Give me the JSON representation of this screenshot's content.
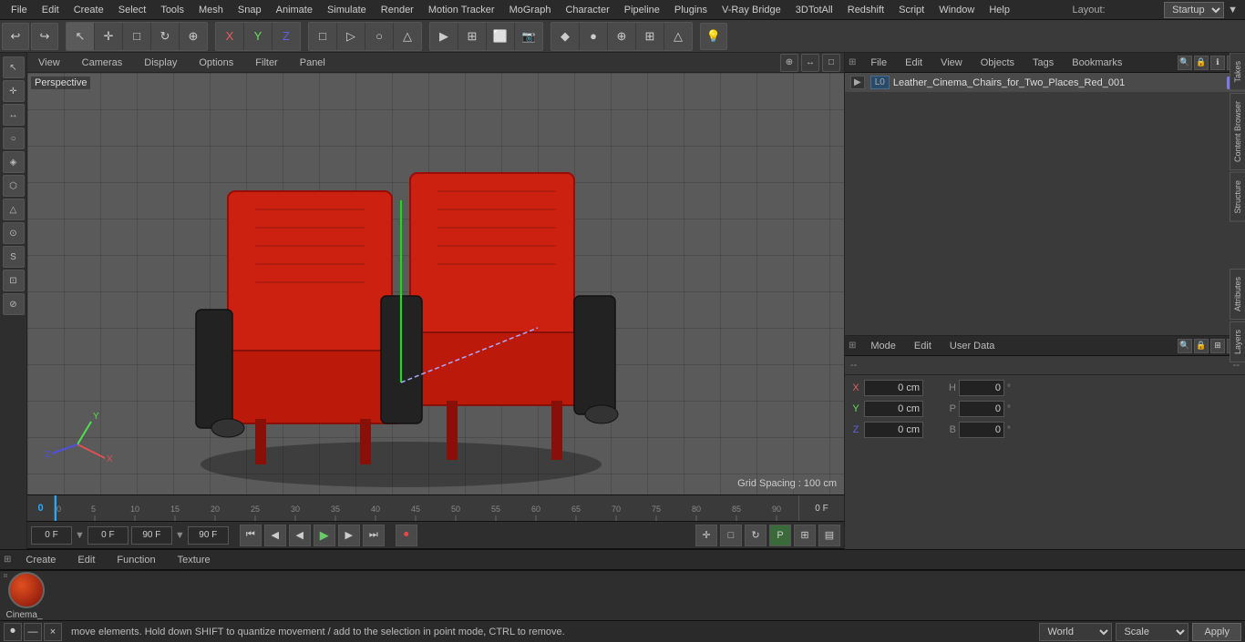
{
  "app": {
    "title": "Cinema 4D"
  },
  "menu": {
    "items": [
      "File",
      "Edit",
      "Create",
      "Select",
      "Tools",
      "Mesh",
      "Snap",
      "Animate",
      "Simulate",
      "Render",
      "Motion Tracker",
      "MoGraph",
      "Character",
      "Pipeline",
      "Plugins",
      "V-Ray Bridge",
      "3DTotAll",
      "Redshift",
      "Script",
      "Window",
      "Help"
    ],
    "layout_label": "Layout:",
    "layout_value": "Startup"
  },
  "toolbar": {
    "undo_icon": "↩",
    "redo_icon": "↪",
    "mode_icons": [
      "↖",
      "+",
      "□",
      "↻",
      "⊕"
    ],
    "axis_icons": [
      "X",
      "Y",
      "Z"
    ],
    "shape_icons": [
      "□",
      "▷",
      "○",
      "△"
    ],
    "render_icons": [
      "▶",
      "⊞",
      "⬜",
      "📷"
    ],
    "object_icons": [
      "◆",
      "●",
      "⊕",
      "⊞",
      "△"
    ],
    "light_icon": "💡"
  },
  "viewport": {
    "label": "Perspective",
    "tabs": [
      "View",
      "Cameras",
      "Display",
      "Options",
      "Filter",
      "Panel"
    ],
    "grid_spacing": "Grid Spacing : 100 cm"
  },
  "timeline": {
    "frame_start": "0",
    "frame_end": "0 F",
    "ticks": [
      "0",
      "5",
      "10",
      "15",
      "20",
      "25",
      "30",
      "35",
      "40",
      "45",
      "50",
      "55",
      "60",
      "65",
      "70",
      "75",
      "80",
      "85",
      "90"
    ],
    "current_frame_display": "0 F"
  },
  "playback": {
    "field1_value": "0 F",
    "field2_value": "0 F",
    "field3_value": "90 F",
    "field4_value": "90 F",
    "buttons": [
      "⏮",
      "◀◀",
      "◀",
      "▶",
      "▶▶",
      "⏭",
      "⏺"
    ]
  },
  "object_panel": {
    "tabs": [
      "File",
      "Edit",
      "View",
      "Objects",
      "Tags",
      "Bookmarks"
    ],
    "object_name": "Leather_Cinema_Chairs_for_Two_Places_Red_001",
    "object_icon": "L0",
    "vtabs": [
      "Takes",
      "Content Browser",
      "Structure"
    ]
  },
  "attributes_panel": {
    "tabs": [
      "Mode",
      "Edit",
      "User Data"
    ],
    "header_dashes": [
      "--",
      "--"
    ],
    "rows": [
      {
        "label": "X",
        "value1": "0 cm",
        "unit1": "",
        "label2": "H",
        "value2": "0 °"
      },
      {
        "label": "Y",
        "value1": "0 cm",
        "unit1": "",
        "label2": "P",
        "value2": "0 °"
      },
      {
        "label": "Z",
        "value1": "0 cm",
        "unit1": "",
        "label2": "B",
        "value2": "0 °"
      }
    ],
    "vtabs": [
      "Attributes",
      "Layers"
    ]
  },
  "material_bar": {
    "tabs": [
      "Create",
      "Edit",
      "Function",
      "Texture"
    ],
    "material_name": "Cinema_",
    "icons": [
      "mat1"
    ]
  },
  "bottom_bar": {
    "status_text": "move elements. Hold down SHIFT to quantize movement / add to the selection in point mode, CTRL to remove.",
    "world_label": "World",
    "scale_label": "Scale",
    "apply_label": "Apply",
    "taskbar_icons": [
      "⏺",
      "□",
      "×"
    ]
  },
  "left_sidebar": {
    "icons": [
      "↖",
      "✛",
      "↔",
      "○",
      "◈",
      "⬡",
      "△",
      "⊙",
      "S",
      "⊡",
      "⊘"
    ]
  }
}
